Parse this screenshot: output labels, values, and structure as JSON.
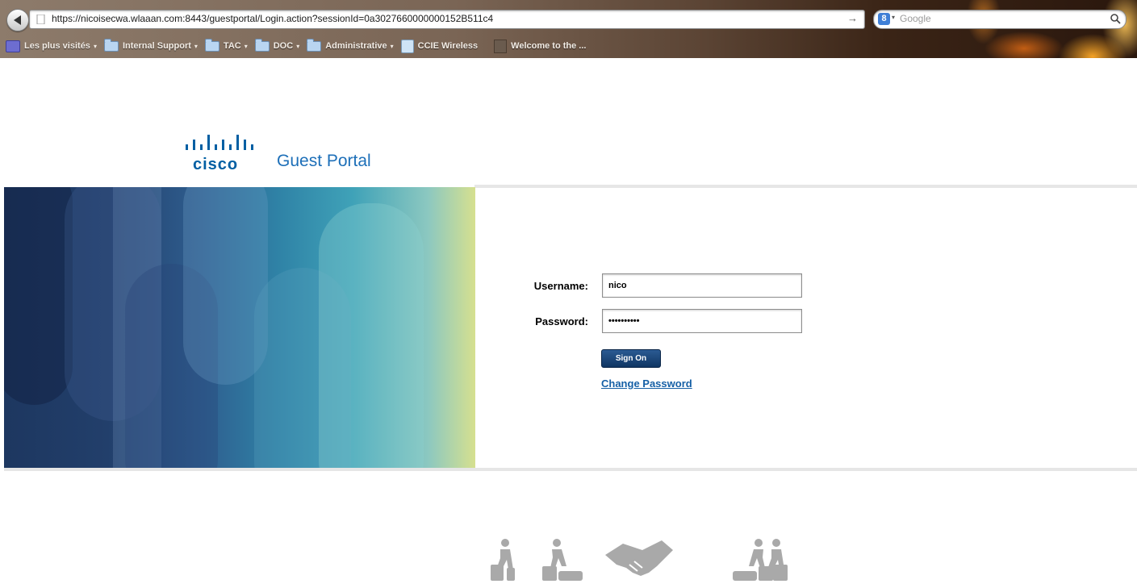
{
  "browser": {
    "url": "https://nicoisecwa.wlaaan.com:8443/guestportal/Login.action?sessionId=0a3027660000000152B511c4",
    "search_placeholder": "Google",
    "search_engine_icon": "google-icon",
    "bookmarks": [
      {
        "label": "Les plus visités",
        "icon": "smart-folder-icon",
        "has_menu": true
      },
      {
        "label": "Internal Support",
        "icon": "folder-icon",
        "has_menu": true
      },
      {
        "label": "TAC",
        "icon": "folder-icon",
        "has_menu": true
      },
      {
        "label": "DOC",
        "icon": "folder-icon",
        "has_menu": true
      },
      {
        "label": "Administrative",
        "icon": "folder-icon",
        "has_menu": true
      },
      {
        "label": "CCIE Wireless",
        "icon": "wireless-icon",
        "has_menu": false
      },
      {
        "label": "Welcome to the ...",
        "icon": "page-icon",
        "has_menu": false
      }
    ]
  },
  "portal": {
    "brand": "cisco",
    "title": "Guest Portal",
    "username_label": "Username:",
    "username_value": "nico",
    "password_label": "Password:",
    "password_value": "cisco12345",
    "sign_on_label": "Sign On",
    "change_password_label": "Change Password",
    "link_color": "#1660a6",
    "brand_color": "#005fa3"
  },
  "footer": {
    "icons": [
      "traveler-luggage-icon",
      "traveler-bags-icon",
      "handshake-icon",
      "traveler-bags-icon",
      "traveler-luggage-icon"
    ]
  }
}
